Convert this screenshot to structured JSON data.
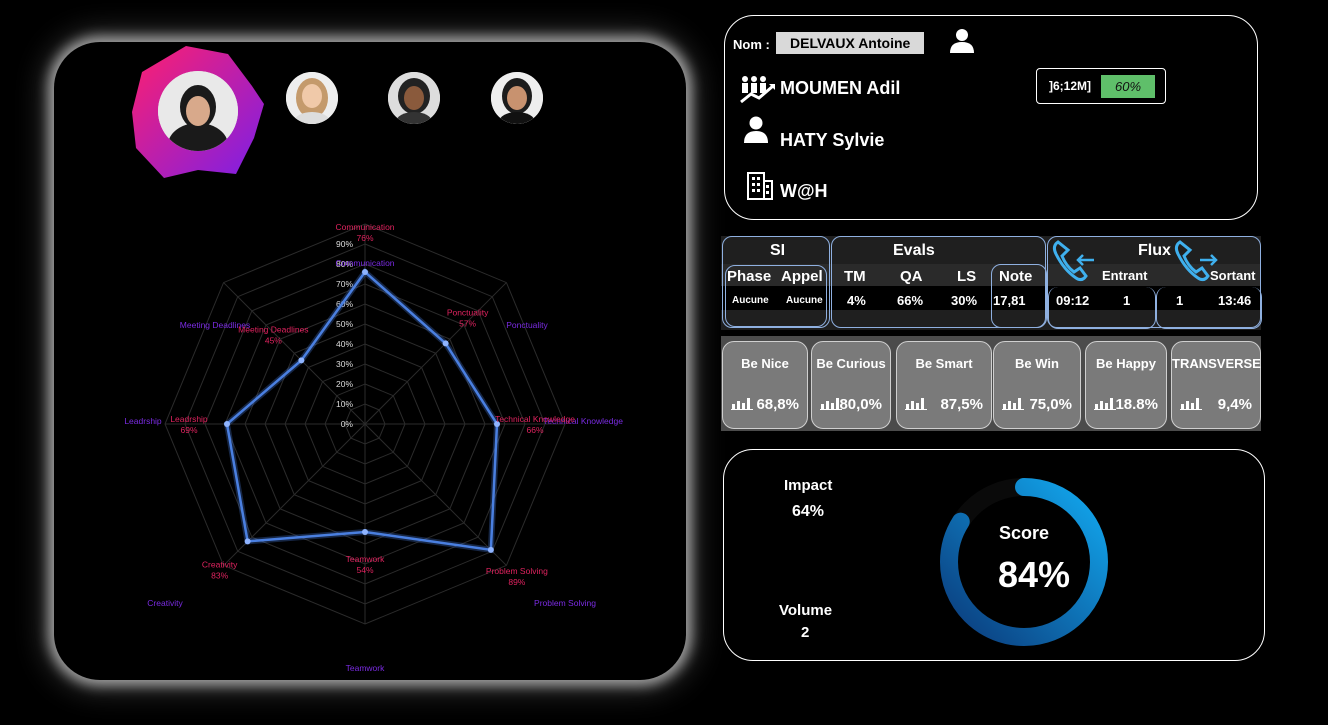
{
  "radar": {
    "center_marker_labels": [
      "90%",
      "80%",
      "70%",
      "60%",
      "50%",
      "40%",
      "30%",
      "20%",
      "10%",
      "0%"
    ],
    "axes": [
      {
        "outer": "Communication",
        "inner": "Communication",
        "value_text": "76%",
        "value": 76
      },
      {
        "outer": "Ponctuality",
        "inner": "Ponctuality",
        "value_text": "57%",
        "value": 57
      },
      {
        "outer": "Technical Knowledge",
        "inner": "Technical Knowledge",
        "value_text": "66%",
        "value": 66
      },
      {
        "outer": "Problem Solving",
        "inner": "Problem Solving",
        "value_text": "89%",
        "value": 89
      },
      {
        "outer": "Teamwork",
        "inner": "Teamwork",
        "value_text": "54%",
        "value": 54
      },
      {
        "outer": "Creativity",
        "inner": "Creativity",
        "value_text": "83%",
        "value": 83
      },
      {
        "outer": "Leadrship",
        "inner": "Leadrship",
        "value_text": "69%",
        "value": 69
      },
      {
        "outer": "Meeting Deadlines",
        "inner": "Meeting Deadlines",
        "value_text": "45%",
        "value": 45
      }
    ],
    "colors": {
      "line": "#4a7fe0",
      "outer_label": "#7a2be2",
      "inner_label": "#e0235f"
    }
  },
  "info": {
    "nom_label": "Nom :",
    "nom_value": "DELVAUX Antoine",
    "manager": "MOUMEN Adil",
    "supervisor": "HATY Sylvie",
    "site": "W@H",
    "tenure_label": "]6;12M]",
    "tenure_pct": "60%"
  },
  "stats": {
    "si": {
      "title": "SI",
      "phase_label": "Phase",
      "appel_label": "Appel",
      "phase": "Aucune",
      "appel": "Aucune"
    },
    "evals": {
      "title": "Evals",
      "tm_label": "TM",
      "qa_label": "QA",
      "ls_label": "LS",
      "tm": "4%",
      "qa": "66%",
      "ls": "30%"
    },
    "note": {
      "label": "Note",
      "value": "17,81"
    },
    "flux": {
      "title": "Flux",
      "entrant_label": "Entrant",
      "sortant_label": "Sortant",
      "entrant_time": "09:12",
      "entrant_count": "1",
      "sortant_count": "1",
      "sortant_time": "13:46"
    }
  },
  "values": [
    {
      "title": "Be Nice",
      "value": "68,8%"
    },
    {
      "title": "Be Curious",
      "value": "80,0%"
    },
    {
      "title": "Be Smart",
      "value": "87,5%"
    },
    {
      "title": "Be Win",
      "value": "75,0%"
    },
    {
      "title": "Be Happy",
      "value": "18.8%"
    },
    {
      "title": "TRANSVERSE",
      "value": "9,4%"
    }
  ],
  "score": {
    "impact_label": "Impact",
    "impact_value": "64%",
    "volume_label": "Volume",
    "volume_value": "2",
    "score_label": "Score",
    "score_value": "84%",
    "score": 84
  },
  "colors": {
    "accent_green": "#5fbf6a",
    "gauge_light": "#12a9f0",
    "gauge_dark": "#0b3a7a"
  }
}
